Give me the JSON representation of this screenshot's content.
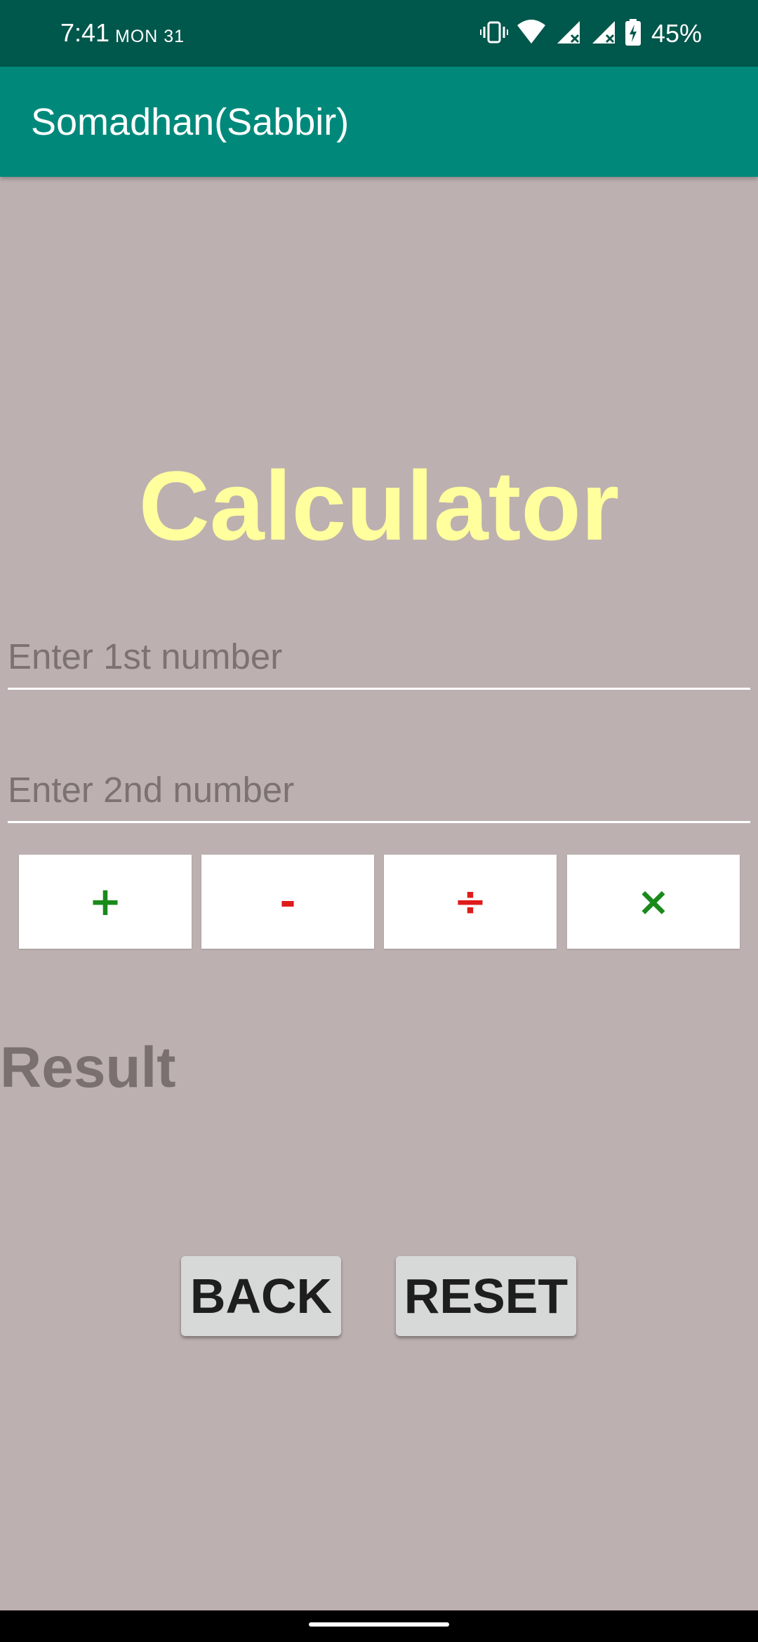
{
  "status_bar": {
    "time": "7:41",
    "date": "MON 31",
    "battery": "45%",
    "icons": [
      "vibrate-icon",
      "wifi-icon",
      "signal-icon",
      "signal-icon",
      "battery-charging-icon"
    ]
  },
  "app_bar": {
    "title": "Somadhan(Sabbir)"
  },
  "main": {
    "title": "Calculator",
    "first_number": {
      "value": "",
      "placeholder": "Enter 1st number"
    },
    "second_number": {
      "value": "",
      "placeholder": "Enter 2nd number"
    },
    "operators": {
      "add": "+",
      "subtract": "-",
      "divide": "÷",
      "multiply": "×"
    },
    "result_label": "Result",
    "back_label": "BACK",
    "reset_label": "RESET"
  },
  "colors": {
    "status_bar": "#00574b",
    "app_bar": "#00897b",
    "background": "#bdb0b0",
    "title": "#ffff9e",
    "add_multiply": "#1a8a1a",
    "subtract_divide": "#e01b1b"
  }
}
